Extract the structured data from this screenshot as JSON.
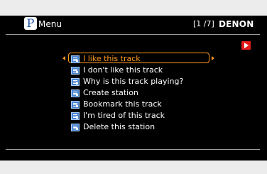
{
  "header": {
    "badge": "P",
    "title": "Menu",
    "page_indicator": "[1 /7]",
    "brand": "DENON"
  },
  "menu": {
    "items": [
      {
        "label": "I like this track",
        "selected": true
      },
      {
        "label": "I don't like this track",
        "selected": false
      },
      {
        "label": "Why is this track playing?",
        "selected": false
      },
      {
        "label": "Create station",
        "selected": false
      },
      {
        "label": "Bookmark this track",
        "selected": false
      },
      {
        "label": "I'm tired of this track",
        "selected": false
      },
      {
        "label": "Delete this station",
        "selected": false
      }
    ]
  },
  "colors": {
    "accent": "#ff9a1f",
    "play": "#e41b1b",
    "icon": "#4a86d4",
    "bars": "#ececec"
  },
  "icons": {
    "play": "play-icon",
    "item": "track-item-icon"
  }
}
